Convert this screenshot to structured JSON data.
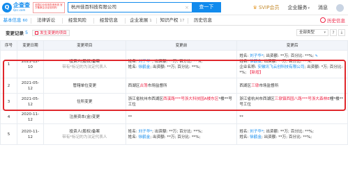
{
  "header": {
    "logo_main": "企查查",
    "logo_sub": "Qcc.com",
    "badge_text": "全国企业信用查询系统 官方备案企业征信机构",
    "search_value": "杭州佳百科技有限公司",
    "search_clear": "×",
    "search_button": "查一下",
    "svip_label": "SVIP会员",
    "nav": [
      "企业服务",
      "消息"
    ],
    "caret": "▾"
  },
  "tabs": [
    {
      "label": "基本信息",
      "count": "60"
    },
    {
      "label": "法律诉讼",
      "count": ""
    },
    {
      "label": "经营风险",
      "count": ""
    },
    {
      "label": "经营信息",
      "count": ""
    },
    {
      "label": "企业发展",
      "count": "1"
    },
    {
      "label": "知识产权",
      "count": "17"
    },
    {
      "label": "历史信息",
      "count": ""
    }
  ],
  "history_label": "历史信息",
  "section": {
    "title": "变更记录",
    "count": "5",
    "chip": "发生变更的项目",
    "select_value": "全部类型",
    "select_caret": "▾",
    "icons": [
      "?",
      "⤓"
    ]
  },
  "table": {
    "headers": [
      "序号",
      "变更日期",
      "变更项目",
      "变更前",
      "变更后"
    ],
    "rows": [
      {
        "no": "1",
        "date": "2021-12-10",
        "item": "投资人(股权)备案",
        "item_sub": "带有*标记的为法定代表人",
        "before": [
          {
            "name_label": "姓名: ",
            "name": "刘子华*",
            "detail": "; 出资额: **万; 百分比: **%;"
          },
          {
            "name_label": "姓名: ",
            "name": "徐鹤金",
            "detail": "; 出资额: **万; 百分比: **%;"
          }
        ],
        "after": [
          {
            "name_label": "姓名: ",
            "name": "刘子华*",
            "detail": "; 出资额: **万; 百分比: **%;"
          },
          {
            "name_label": "姓名: ",
            "name": "徐鹤金",
            "detail": "; 出资额: **万; 百分比: **%;"
          },
          {
            "name_label": "企业名称: ",
            "name": "安徽讯飞云创科技有限公司",
            "detail": "; 出资额: *万; 百分比: *%; ",
            "tag": "【新增】"
          }
        ]
      },
      {
        "no": "2",
        "date": "2021-05-12",
        "item": "管辖单位变更",
        "before_pre": "西湖区",
        "before_red": "古荡",
        "before_post": "市场监督所",
        "after_pre": "西湖区",
        "after_red": "三墩",
        "after_post": "市场监督所"
      },
      {
        "no": "3",
        "date": "2021-05-12",
        "item": "住所变更",
        "before_pre": "浙江省杭州市西湖区",
        "before_red": "西溪路***号浙大科技园A楼东区",
        "before_post": "*楼**号工位",
        "after_pre": "浙江省杭州市西湖区",
        "after_red": "三墩镇西园八路***号浙大森林E",
        "after_post": "幢*楼**号工位"
      },
      {
        "no": "4",
        "date": "2020-11-12",
        "item": "注册资本(金)变更",
        "before_pre": "**",
        "after_pre": "**"
      },
      {
        "no": "5",
        "date": "2020-11-12",
        "item": "投资人(股权)备案",
        "item_sub": "带有*标记的为法定代表人",
        "before": [
          {
            "name_label": "姓名: ",
            "name": "刘子华*",
            "detail": "; 出资额: **万; 百分比: **%;"
          },
          {
            "name_label": "姓名: ",
            "name": "徐鹤金",
            "detail": "; 出资额: **万; 百分比: **%;"
          }
        ],
        "after": [
          {
            "name_label": "姓名: ",
            "name": "刘子华*",
            "detail": "; 出资额: **万; 百分比: **%;"
          },
          {
            "name_label": "姓名: ",
            "name": "徐鹤金",
            "detail": "; 出资额: **万; 百分比: **%;"
          }
        ]
      }
    ]
  },
  "colors": {
    "brand": "#128bed",
    "highlight": "#e0262b",
    "header_bg": "#f2f5fa"
  },
  "icon_names": [
    "qcc-logo-icon",
    "crown-icon",
    "history-icon",
    "help-icon",
    "download-icon",
    "edit-icon",
    "arrow-icon"
  ]
}
